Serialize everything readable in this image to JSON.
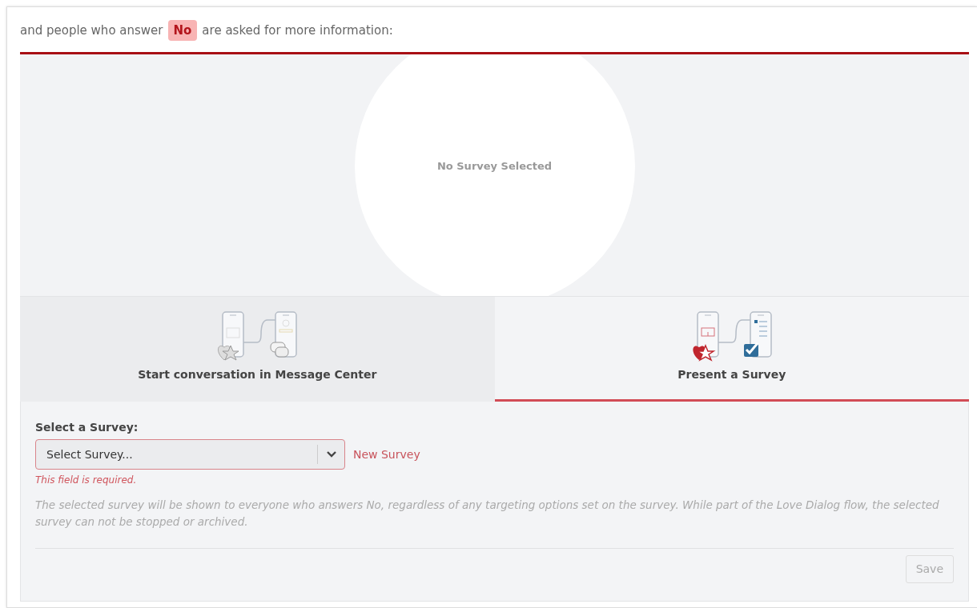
{
  "intro": {
    "before": "and people who answer",
    "answer_badge": "No",
    "after": "are asked for more information:"
  },
  "preview": {
    "empty_text": "No Survey Selected"
  },
  "tabs": [
    {
      "label": "Start conversation in Message Center",
      "kind": "message",
      "selected": false
    },
    {
      "label": "Present a Survey",
      "kind": "survey",
      "selected": true
    }
  ],
  "form": {
    "label": "Select a Survey:",
    "select": {
      "value": "Select Survey...",
      "invalid": true
    },
    "new_link": "New Survey",
    "error": "This field is required.",
    "help": "The selected survey will be shown to everyone who answers No, regardless of any targeting options set on the survey. While part of the Love Dialog flow, the selected survey can not be stopped or archived."
  },
  "save_button": {
    "label": "Save",
    "disabled": true
  }
}
